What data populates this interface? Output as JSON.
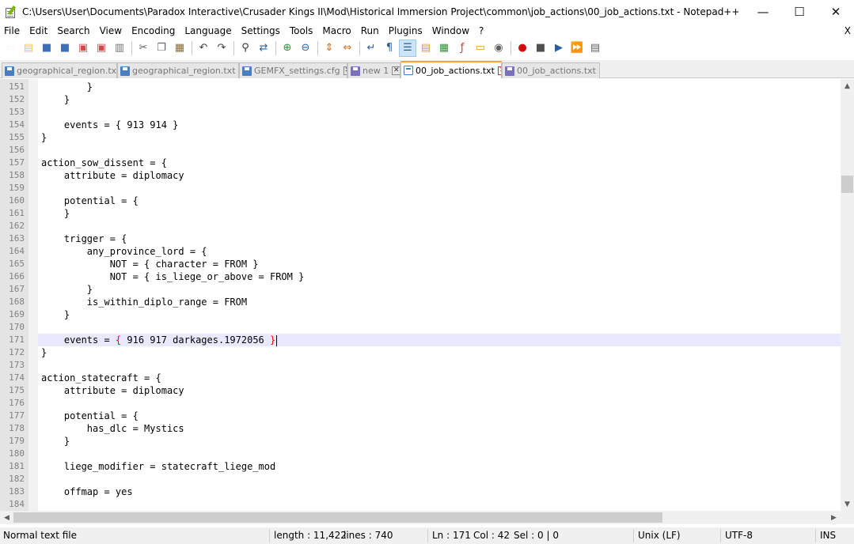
{
  "window": {
    "title": "C:\\Users\\User\\Documents\\Paradox Interactive\\Crusader Kings II\\Mod\\Historical Immersion Project\\common\\job_actions\\00_job_actions.txt - Notepad++",
    "minimize_glyph": "—",
    "maximize_glyph": "☐",
    "close_glyph": "✕"
  },
  "menu": {
    "items": [
      "File",
      "Edit",
      "Search",
      "View",
      "Encoding",
      "Language",
      "Settings",
      "Tools",
      "Macro",
      "Run",
      "Plugins",
      "Window",
      "?"
    ],
    "close_label": "X"
  },
  "toolbar": {
    "icons": [
      "new-file-icon",
      "open-file-icon",
      "save-icon",
      "save-all-icon",
      "close-icon",
      "close-all-icon",
      "print-icon",
      "cut-icon",
      "copy-icon",
      "paste-icon",
      "undo-icon",
      "redo-icon",
      "find-icon",
      "replace-icon",
      "zoom-in-icon",
      "zoom-out-icon",
      "sync-vertical-icon",
      "sync-horizontal-icon",
      "word-wrap-icon",
      "show-all-chars-icon",
      "indent-guide-icon",
      "user-defined-lang-icon",
      "doc-map-icon",
      "function-list-icon",
      "folder-as-workspace-icon",
      "monitoring-icon",
      "record-macro-icon",
      "stop-macro-icon",
      "play-macro-icon",
      "run-macro-multiple-icon",
      "save-macro-icon"
    ]
  },
  "tabs": [
    {
      "label": "geographical_region.txt",
      "active": false,
      "icon": "saved-disk-icon"
    },
    {
      "label": "geographical_region.txt",
      "active": false,
      "icon": "saved-disk-icon"
    },
    {
      "label": "GEMFX_settings.cfg",
      "active": false,
      "icon": "saved-disk-icon"
    },
    {
      "label": "new 1",
      "active": false,
      "icon": "unsaved-disk-icon"
    },
    {
      "label": "00_job_actions.txt",
      "active": true,
      "icon": "outline-disk-icon"
    },
    {
      "label": "00_job_actions.txt",
      "active": false,
      "icon": "unsaved-disk-icon"
    }
  ],
  "editor": {
    "current_line": 171,
    "lines": [
      {
        "n": "151",
        "text": "        }"
      },
      {
        "n": "152",
        "text": "    }"
      },
      {
        "n": "153",
        "text": ""
      },
      {
        "n": "154",
        "text": "    events = { 913 914 }"
      },
      {
        "n": "155",
        "text": "}"
      },
      {
        "n": "156",
        "text": ""
      },
      {
        "n": "157",
        "text": "action_sow_dissent = {"
      },
      {
        "n": "158",
        "text": "    attribute = diplomacy"
      },
      {
        "n": "159",
        "text": ""
      },
      {
        "n": "160",
        "text": "    potential = {"
      },
      {
        "n": "161",
        "text": "    }"
      },
      {
        "n": "162",
        "text": ""
      },
      {
        "n": "163",
        "text": "    trigger = {"
      },
      {
        "n": "164",
        "text": "        any_province_lord = {"
      },
      {
        "n": "165",
        "text": "            NOT = { character = FROM }"
      },
      {
        "n": "166",
        "text": "            NOT = { is_liege_or_above = FROM }"
      },
      {
        "n": "167",
        "text": "        }"
      },
      {
        "n": "168",
        "text": "        is_within_diplo_range = FROM"
      },
      {
        "n": "169",
        "text": "    }"
      },
      {
        "n": "170",
        "text": ""
      },
      {
        "n": "171",
        "text": "    events = ",
        "brace_open": "{",
        "inner": " 916 917 darkages.1972056 ",
        "brace_close": "}"
      },
      {
        "n": "172",
        "text": "}"
      },
      {
        "n": "173",
        "text": ""
      },
      {
        "n": "174",
        "text": "action_statecraft = {"
      },
      {
        "n": "175",
        "text": "    attribute = diplomacy"
      },
      {
        "n": "176",
        "text": ""
      },
      {
        "n": "177",
        "text": "    potential = {"
      },
      {
        "n": "178",
        "text": "        has_dlc = Mystics"
      },
      {
        "n": "179",
        "text": "    }"
      },
      {
        "n": "180",
        "text": ""
      },
      {
        "n": "181",
        "text": "    liege_modifier = statecraft_liege_mod"
      },
      {
        "n": "182",
        "text": ""
      },
      {
        "n": "183",
        "text": "    offmap = yes"
      },
      {
        "n": "184",
        "text": ""
      }
    ]
  },
  "status": {
    "file_type": "Normal text file",
    "length": "length : 11,422",
    "lines": "lines : 740",
    "ln": "Ln : 171",
    "col": "Col : 42",
    "sel": "Sel : 0 | 0",
    "eol": "Unix (LF)",
    "encoding": "UTF-8",
    "mode": "INS"
  },
  "colors": {
    "current_line_bg": "#e8e8ff",
    "brace_highlight": "#ff0000",
    "active_tab_accent": "#f9a33b"
  }
}
